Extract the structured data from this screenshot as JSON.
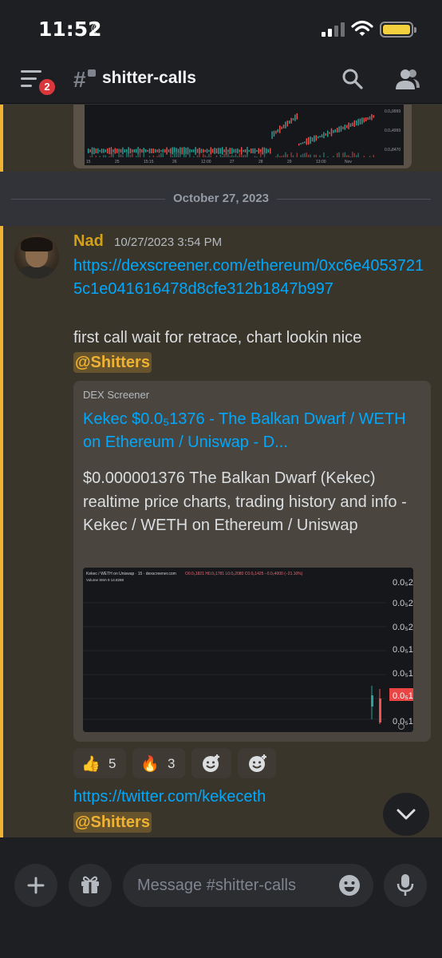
{
  "status_bar": {
    "time": "11:52"
  },
  "header": {
    "channel_name": "shitter-calls",
    "notification_count": "2"
  },
  "top_chart": {
    "x_labels": [
      "15",
      "25",
      "15:15",
      "26",
      "12:00",
      "27",
      "28",
      "29",
      "13:00",
      "Nov"
    ],
    "y_labels": [
      "0.0₄9999",
      "0.0₄4999",
      "0.0₄8470"
    ]
  },
  "date_divider": "October 27, 2023",
  "message": {
    "author": "Nad",
    "timestamp": "10/27/2023 3:54 PM",
    "link": "https://dexscreener.com/ethereum/0xc6e40537215c1e041616478d8cfe312b1847b997",
    "text": "first call wait for retrace, chart lookin nice",
    "mention": "@Shitters",
    "embed": {
      "provider": "DEX Screener",
      "title": "Kekec $0.0₅1376 - The Balkan Dwarf / WETH on Ethereum / Uniswap - D...",
      "description": "$0.000001376 The Balkan Dwarf (Kekec) realtime price charts, trading history and info - Kekec / WETH on Ethereum / Uniswap",
      "chart_header": "Kekec / WETH on Uniswap · 15 · dexscreener.com",
      "chart_ohlc": "O0.0₅1821 H0.0₅1781 L0.0₅2080 C0.0₅1425 −0.0₅4000 (−21.10%)",
      "chart_volume": "Volume  SMA 9  14.8288",
      "y_labels": [
        "0.0₅2",
        "0.0₅2",
        "0.0₅2",
        "0.0₅1",
        "0.0₅1",
        "0.0₅1",
        "0.0₅1"
      ]
    },
    "reactions": [
      {
        "emoji": "👍",
        "count": "5"
      },
      {
        "emoji": "🔥",
        "count": "3"
      }
    ]
  },
  "next_message": {
    "link": "https://twitter.com/kekeceth",
    "mention": "@Shitters"
  },
  "input": {
    "placeholder": "Message #shitter-calls"
  },
  "colors": {
    "accent": "#f0b232",
    "link": "#00a8fc",
    "background": "#313338",
    "bar": "#1e1f22"
  }
}
